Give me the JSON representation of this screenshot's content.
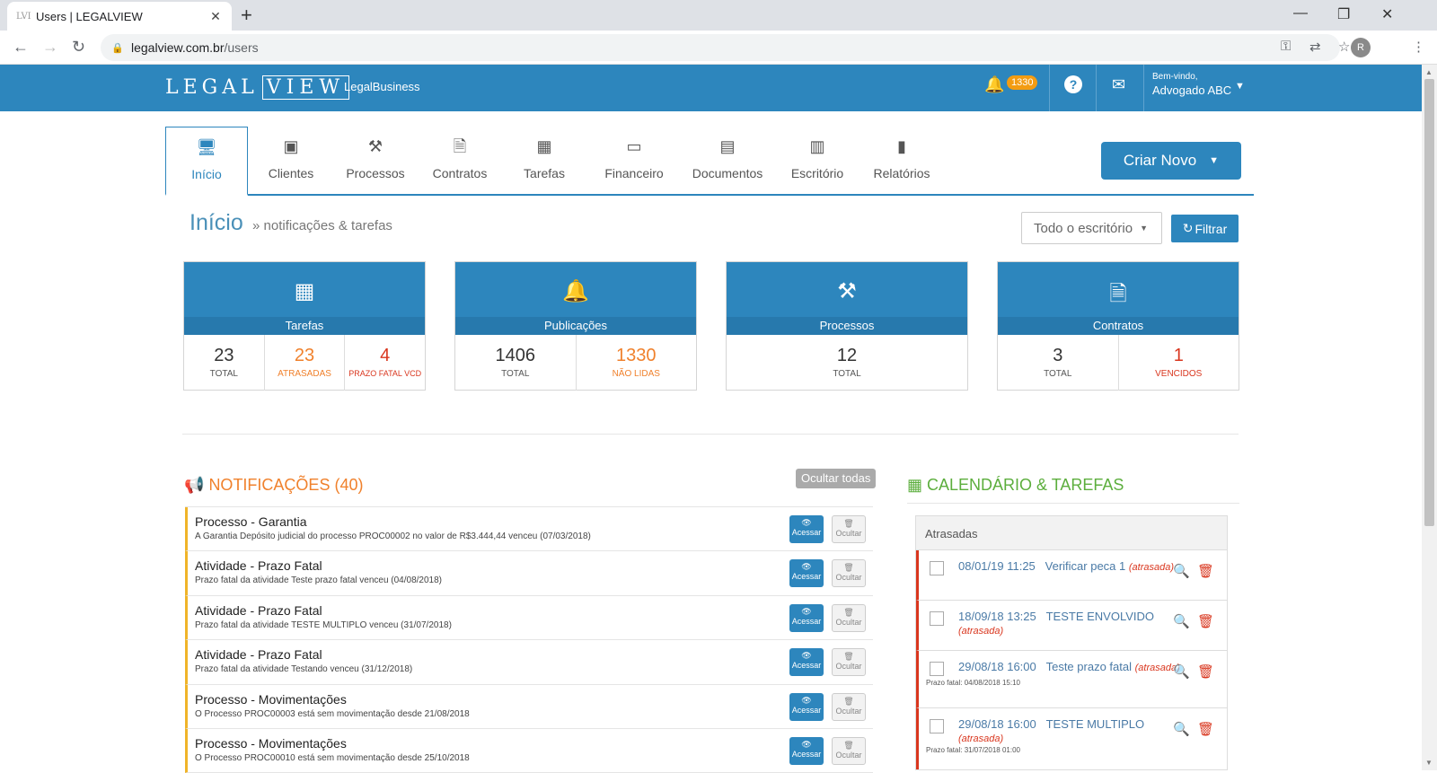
{
  "browser": {
    "tab_title": "Users | LEGALVIEW",
    "tab_favicon_text": "LVI",
    "url_host": "legalview.com.br",
    "url_path": "/users",
    "profile_initial": "R"
  },
  "topbar": {
    "logo_left": "LEGAL",
    "logo_right": "VIEW",
    "brand": "LegalBusiness",
    "notifications_count": "1330",
    "welcome_small": "Bem-vindo,",
    "user_name": "Advogado ABC"
  },
  "nav": {
    "tabs": [
      {
        "label": "Início",
        "icon": "monitor-icon"
      },
      {
        "label": "Clientes",
        "icon": "contact-card-icon"
      },
      {
        "label": "Processos",
        "icon": "gavel-icon"
      },
      {
        "label": "Contratos",
        "icon": "document-icon"
      },
      {
        "label": "Tarefas",
        "icon": "calendar-icon"
      },
      {
        "label": "Financeiro",
        "icon": "money-icon"
      },
      {
        "label": "Documentos",
        "icon": "archive-icon"
      },
      {
        "label": "Escritório",
        "icon": "building-icon"
      },
      {
        "label": "Relatórios",
        "icon": "bar-chart-icon"
      }
    ],
    "active": "Início",
    "create_button": "Criar Novo"
  },
  "page": {
    "title": "Início",
    "subtitle": "» notificações & tarefas",
    "office_select": "Todo o escritório",
    "filter_button": "Filtrar"
  },
  "cards": [
    {
      "title": "Tarefas",
      "icon": "calendar-icon",
      "stats": [
        {
          "value": "23",
          "label": "TOTAL"
        },
        {
          "value": "23",
          "label": "ATRASADAS"
        },
        {
          "value": "4",
          "label": "PRAZO FATAL VCD"
        }
      ]
    },
    {
      "title": "Publicações",
      "icon": "bell-icon",
      "stats": [
        {
          "value": "1406",
          "label": "TOTAL"
        },
        {
          "value": "1330",
          "label": "NÃO LIDAS"
        }
      ]
    },
    {
      "title": "Processos",
      "icon": "gavel-icon",
      "stats": [
        {
          "value": "12",
          "label": "TOTAL"
        }
      ]
    },
    {
      "title": "Contratos",
      "icon": "document-icon",
      "stats": [
        {
          "value": "3",
          "label": "TOTAL"
        },
        {
          "value": "1",
          "label": "VENCIDOS"
        }
      ]
    }
  ],
  "notifications": {
    "heading": "NOTIFICAÇÕES (40)",
    "hide_all": "Ocultar todas",
    "access_label": "Acessar",
    "hide_label": "Ocultar",
    "items": [
      {
        "title": "Processo - Garantia",
        "desc": "A Garantia Depósito judicial do processo PROC00002 no valor de R$3.444,44 venceu (07/03/2018)"
      },
      {
        "title": "Atividade - Prazo Fatal",
        "desc": "Prazo fatal da atividade Teste prazo fatal venceu (04/08/2018)"
      },
      {
        "title": "Atividade - Prazo Fatal",
        "desc": "Prazo fatal da atividade TESTE MULTIPLO venceu (31/07/2018)"
      },
      {
        "title": "Atividade - Prazo Fatal",
        "desc": "Prazo fatal da atividade Testando venceu (31/12/2018)"
      },
      {
        "title": "Processo - Movimentações",
        "desc": "O Processo PROC00003 está sem movimentação desde 21/08/2018"
      },
      {
        "title": "Processo - Movimentações",
        "desc": "O Processo PROC00010 está sem movimentação desde 25/10/2018"
      }
    ]
  },
  "calendar": {
    "heading": "CALENDÁRIO & TAREFAS",
    "panel_title": "Atrasadas",
    "items": [
      {
        "datetime": "08/01/19 11:25",
        "task": "Verificar peca 1",
        "status": "(atrasada)",
        "prazo": ""
      },
      {
        "datetime": "18/09/18 13:25",
        "task": "TESTE ENVOLVIDO",
        "status": "(atrasada)",
        "prazo": ""
      },
      {
        "datetime": "29/08/18 16:00",
        "task": "Teste prazo fatal",
        "status": "(atrasada)",
        "prazo": "Prazo fatal: 04/08/2018 15:10"
      },
      {
        "datetime": "29/08/18 16:00",
        "task": "TESTE MULTIPLO",
        "status": "(atrasada)",
        "prazo": "Prazo fatal: 31/07/2018 01:00"
      }
    ]
  },
  "colors": {
    "primary": "#2d86bd",
    "orange": "#f0812c",
    "red": "#d9361e",
    "green": "#5cae3d",
    "badge": "#f39c12"
  }
}
